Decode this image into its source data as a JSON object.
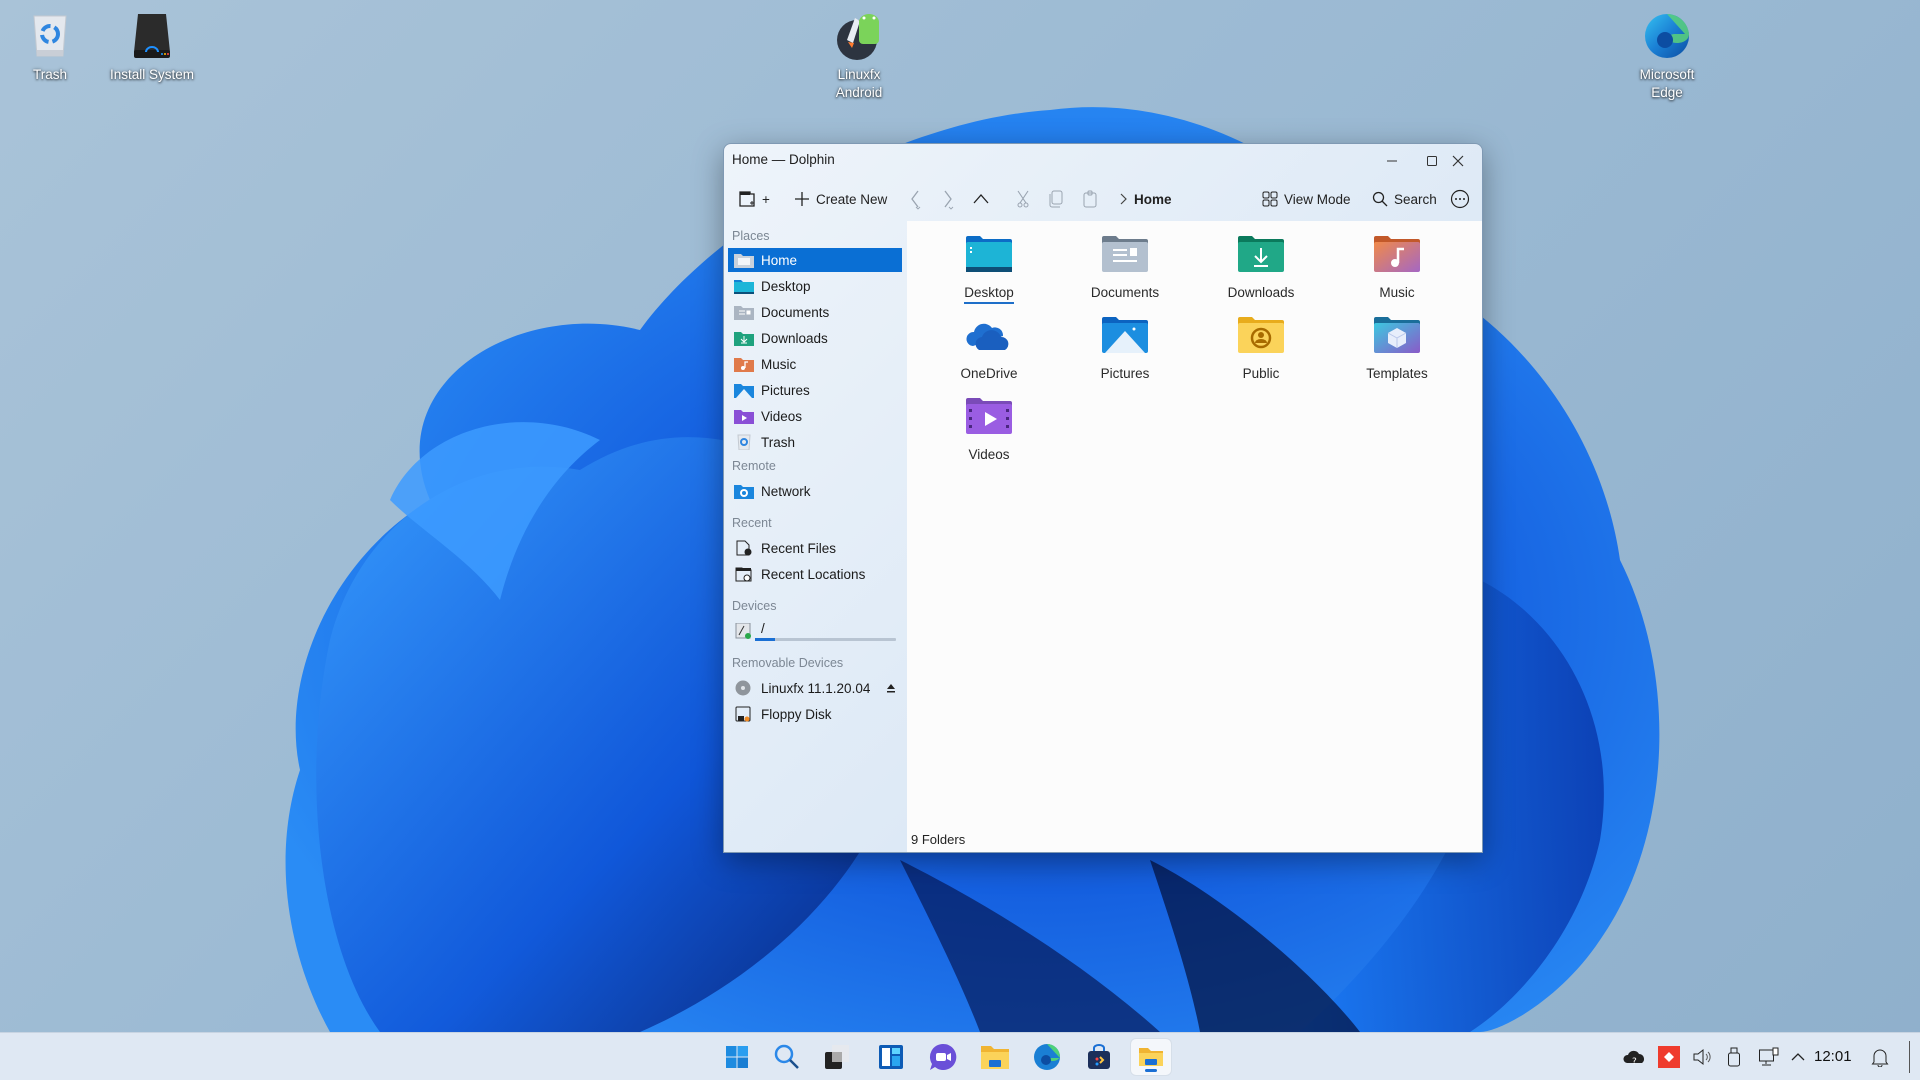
{
  "desktop": {
    "icons": [
      {
        "label": "Trash",
        "icon": "trash-icon"
      },
      {
        "label": "Install System",
        "icon": "install-drive-icon"
      },
      {
        "label": "Linuxfx Android",
        "line1": "Linuxfx",
        "line2": "Android",
        "icon": "android-icon"
      },
      {
        "label": "Microsoft Edge",
        "line1": "Microsoft",
        "line2": "Edge",
        "icon": "edge-icon"
      }
    ]
  },
  "window": {
    "title": "Home — Dolphin",
    "controls": {
      "minimize": "minimize",
      "maximize": "maximize",
      "close": "close"
    },
    "toolbar": {
      "new_tab_label": "+",
      "create_new_label": "Create New",
      "breadcrumb_current": "Home",
      "view_mode_label": "View Mode",
      "search_label": "Search"
    },
    "sidebar": {
      "sections": {
        "places": "Places",
        "remote": "Remote",
        "recent": "Recent",
        "devices": "Devices",
        "removable": "Removable Devices"
      },
      "places": [
        {
          "label": "Home",
          "selected": true
        },
        {
          "label": "Desktop"
        },
        {
          "label": "Documents"
        },
        {
          "label": "Downloads"
        },
        {
          "label": "Music"
        },
        {
          "label": "Pictures"
        },
        {
          "label": "Videos"
        },
        {
          "label": "Trash"
        }
      ],
      "remote": [
        {
          "label": "Network"
        }
      ],
      "recent": [
        {
          "label": "Recent Files"
        },
        {
          "label": "Recent Locations"
        }
      ],
      "devices": [
        {
          "label": "/",
          "usage_fraction": 0.14
        }
      ],
      "removable": [
        {
          "label": "Linuxfx 11.1.20.04",
          "ejectable": true
        },
        {
          "label": "Floppy Disk"
        }
      ]
    },
    "folders": [
      {
        "label": "Desktop",
        "current": true
      },
      {
        "label": "Documents"
      },
      {
        "label": "Downloads"
      },
      {
        "label": "Music"
      },
      {
        "label": "OneDrive"
      },
      {
        "label": "Pictures"
      },
      {
        "label": "Public"
      },
      {
        "label": "Templates"
      },
      {
        "label": "Videos"
      }
    ],
    "status": "9 Folders"
  },
  "taskbar": {
    "apps": [
      "Start",
      "Search",
      "Task View",
      "Widgets",
      "Chat",
      "File Explorer",
      "Microsoft Edge",
      "Store",
      "Dolphin"
    ],
    "clock": "12:01"
  },
  "colors": {
    "accent": "#0a6fd4",
    "taskbar_bg": "#dfe8f3"
  }
}
